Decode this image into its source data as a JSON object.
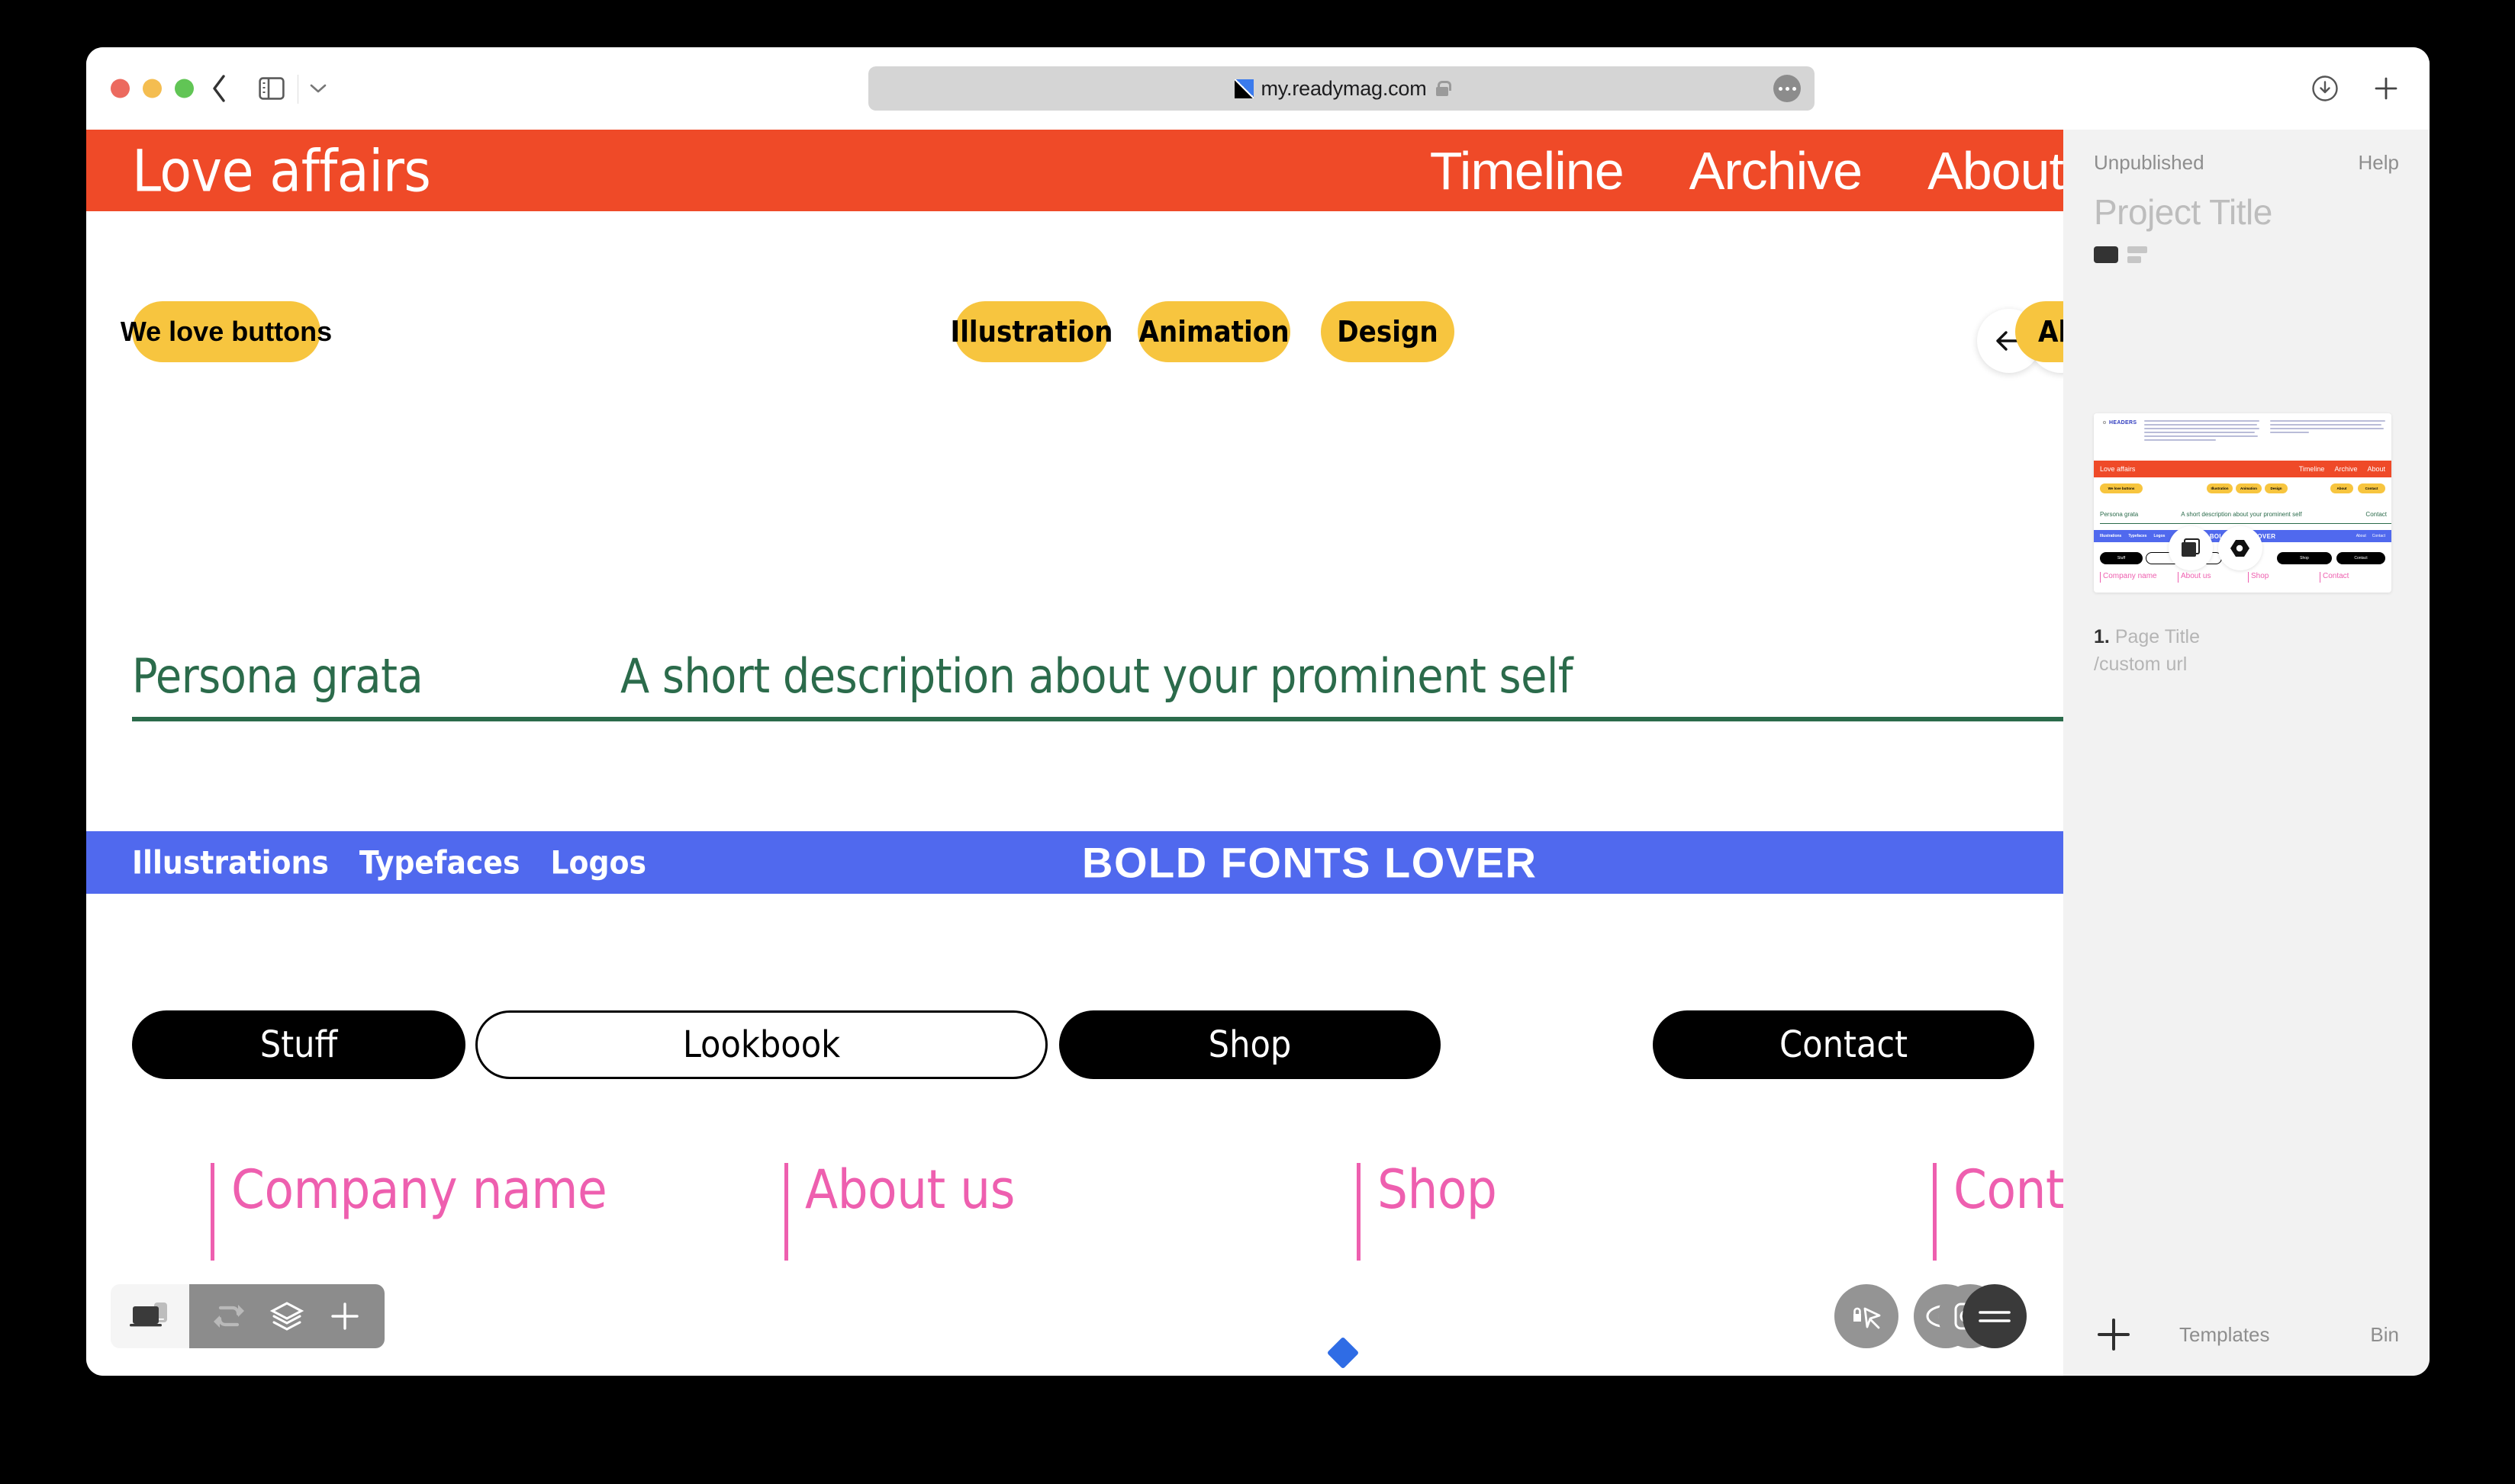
{
  "browser": {
    "url": "my.readymag.com",
    "favicon_icon": "readymag-favicon",
    "lock_icon": "lock-icon",
    "back_icon": "chevron-left-icon",
    "sidebar_toggle_icon": "sidebar-panel-icon",
    "chevron_icon": "chevron-down-icon",
    "more_icon": "ellipsis-icon",
    "download_icon": "download-icon",
    "new_tab_icon": "plus-icon"
  },
  "canvas": {
    "header": {
      "brand": "Love affairs",
      "nav": [
        "Timeline",
        "Archive",
        "About"
      ],
      "bg_color": "#ef4a28",
      "back_icon": "arrow-left-icon",
      "add_icon": "plus-icon"
    },
    "yellow_buttons": [
      {
        "label": "We love buttons"
      },
      {
        "label": "Illustration"
      },
      {
        "label": "Animation"
      },
      {
        "label": "Design"
      },
      {
        "label": "About"
      }
    ],
    "yellow_color": "#f7c53f",
    "green_section": {
      "title": "Persona grata",
      "description": "A short description about your prominent self",
      "color": "#2b6b4b"
    },
    "blue_bar": {
      "nav": [
        "Illustrations",
        "Typefaces",
        "Logos"
      ],
      "title": "BOLD FONTS LOVER",
      "bg_color": "#5069ee"
    },
    "dark_pills": [
      {
        "label": "Stuff",
        "style": "filled"
      },
      {
        "label": "Lookbook",
        "style": "outline"
      },
      {
        "label": "Shop",
        "style": "filled"
      },
      {
        "label": "Contact",
        "style": "filled"
      }
    ],
    "pink_links": [
      "Company name",
      "About us",
      "Shop",
      "Contact"
    ],
    "pink_color": "#ee5faf",
    "anchor_marker_color": "#2f6ce5"
  },
  "toolbar_left": {
    "device_icon": "desktop-mobile-preview-icon",
    "buttons": [
      {
        "icon": "undo-redo-icon"
      },
      {
        "icon": "layers-icon"
      },
      {
        "icon": "plus-icon"
      }
    ]
  },
  "toolbar_right": {
    "buttons": [
      {
        "icon": "lock-cursor-icon"
      },
      {
        "icon": "eye-preview-icon"
      },
      {
        "icon": "menu-equals-icon"
      },
      {
        "icon": "settings-nut-icon"
      }
    ]
  },
  "sidebar": {
    "status": "Unpublished",
    "help": "Help",
    "project_title_placeholder": "Project Title",
    "viewmode_solid_icon": "view-single-icon",
    "viewmode_split_icon": "view-list-icon",
    "page": {
      "number": "1.",
      "title": "Page Title",
      "url": "/custom url"
    },
    "thumbnail": {
      "headers_label": "HEADERS",
      "body_columns": [
        "This is what people see in the first seconds of loading a website, so a header should provide basic information about your site and help users understand what it offers at once. It usually includes a brand logo or identifier, navigation elements, and some kind of call to action.",
        "A header is usually fixed to the top of the page. To have it appear on all the pages of your Readymag project, switch on the On all pages toggle. A burger menu will be very useful for mobile."
      ],
      "brand": "Love affairs",
      "nav": [
        "Timeline",
        "Archive",
        "About"
      ],
      "yellow_buttons": [
        "We love buttons",
        "Illustration",
        "Animation",
        "Design",
        "About",
        "Contact"
      ],
      "green_title": "Persona grata",
      "green_description": "A short description about your prominent self",
      "green_contact": "Contact",
      "blue_nav": [
        "Illustrations",
        "Typefaces",
        "Logos"
      ],
      "blue_title": "BOLD FONTS LOVER",
      "blue_right": [
        "About",
        "Contact"
      ],
      "dark_pills": [
        "Stuff",
        "Lookbook",
        "Shop",
        "Contact"
      ],
      "pink_links": [
        "Company name",
        "About us",
        "Shop",
        "Contact"
      ],
      "overlay_1_icon": "duplicate-icon",
      "overlay_2_icon": "settings-nut-icon"
    },
    "add_page_icon": "plus-icon",
    "templates": "Templates",
    "bin": "Bin"
  }
}
